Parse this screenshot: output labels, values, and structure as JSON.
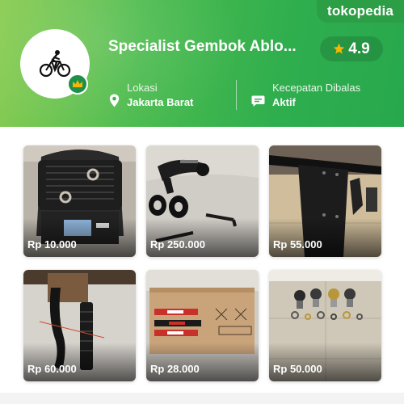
{
  "brand": {
    "logo_text": "tokopedia"
  },
  "shop": {
    "name": "Specialist Gembok Ablo...",
    "rating": "4.9",
    "location_label": "Lokasi",
    "location_value": "Jakarta Barat",
    "response_label": "Kecepatan Dibalas",
    "response_value": "Aktif"
  },
  "icons": {
    "avatar": "cyclist-icon",
    "badge": "crown-icon",
    "rating": "star-icon",
    "location": "map-pin-icon",
    "response": "chat-bubble-icon"
  },
  "colors": {
    "header_start": "#8ccd54",
    "header_end": "#28a84d",
    "badge": "#1f8f4a",
    "star": "#f7b500"
  },
  "products": [
    {
      "price": "Rp 10.000"
    },
    {
      "price": "Rp 250.000"
    },
    {
      "price": "Rp 55.000"
    },
    {
      "price": "Rp 60.000"
    },
    {
      "price": "Rp 28.000"
    },
    {
      "price": "Rp 50.000"
    }
  ]
}
